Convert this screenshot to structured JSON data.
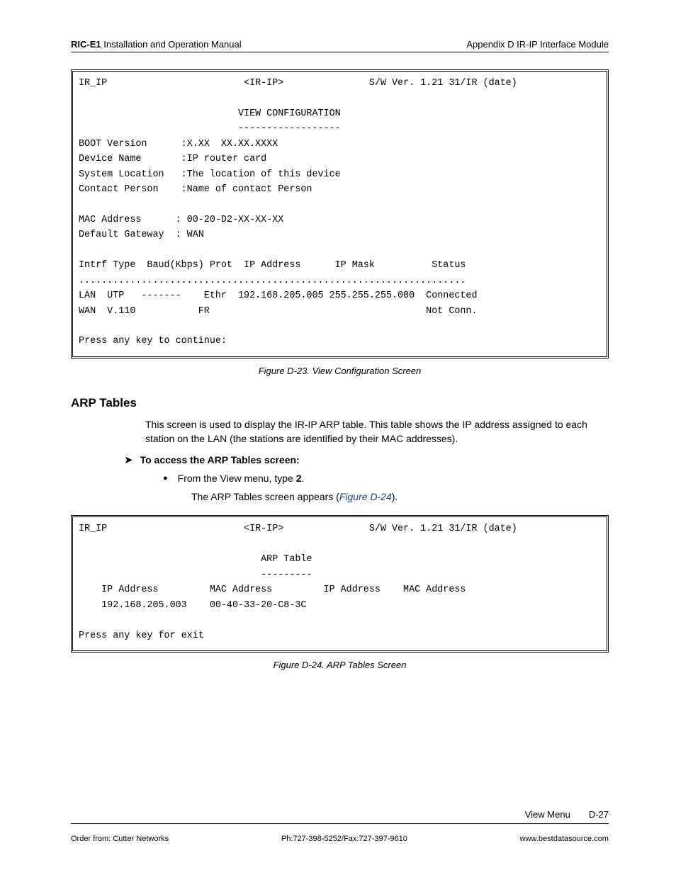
{
  "header": {
    "product": "RIC-E1",
    "manual": " Installation and Operation Manual",
    "right": "Appendix D  IR-IP Interface Module"
  },
  "terminal1": "IR_IP                        <IR-IP>               S/W Ver. 1.21 31/IR (date)\n\n                            VIEW CONFIGURATION\n                            ------------------\nBOOT Version      :X.XX  XX.XX.XXXX\nDevice Name       :IP router card\nSystem Location   :The location of this device\nContact Person    :Name of contact Person\n\nMAC Address      : 00-20-D2-XX-XX-XX\nDefault Gateway  : WAN\n\nIntrf Type  Baud(Kbps) Prot  IP Address      IP Mask          Status\n....................................................................\nLAN  UTP   -------    Ethr  192.168.205.005 255.255.255.000  Connected\nWAN  V.110           FR                                      Not Conn.\n\nPress any key to continue:",
  "fig1_caption": "Figure D-23.  View Configuration Screen",
  "section_title": "ARP Tables",
  "body1": "This screen is used to display the IR-IP ARP table. This table shows the IP address assigned to each station on the LAN (the stations are identified by their MAC addresses).",
  "proc": "To access the ARP Tables screen:",
  "bullet_pre": "From the View menu, type ",
  "bullet_key": "2",
  "bullet_post": ".",
  "sub_pre": "The ARP Tables screen appears (",
  "sub_ref": "Figure D-24",
  "sub_post": ").",
  "terminal2": "IR_IP                        <IR-IP>               S/W Ver. 1.21 31/IR (date)\n\n                                ARP Table\n                                ---------\n    IP Address         MAC Address         IP Address    MAC Address\n    192.168.205.003    00-40-33-20-C8-3C\n\nPress any key for exit",
  "fig2_caption": "Figure D-24.  ARP Tables Screen",
  "footer_top_label": "View Menu",
  "footer_top_page": "D-27",
  "footer_bottom": {
    "left": "Order from: Cutter Networks",
    "mid": "Ph:727-398-5252/Fax:727-397-9610",
    "right": "www.bestdatasource.com"
  }
}
